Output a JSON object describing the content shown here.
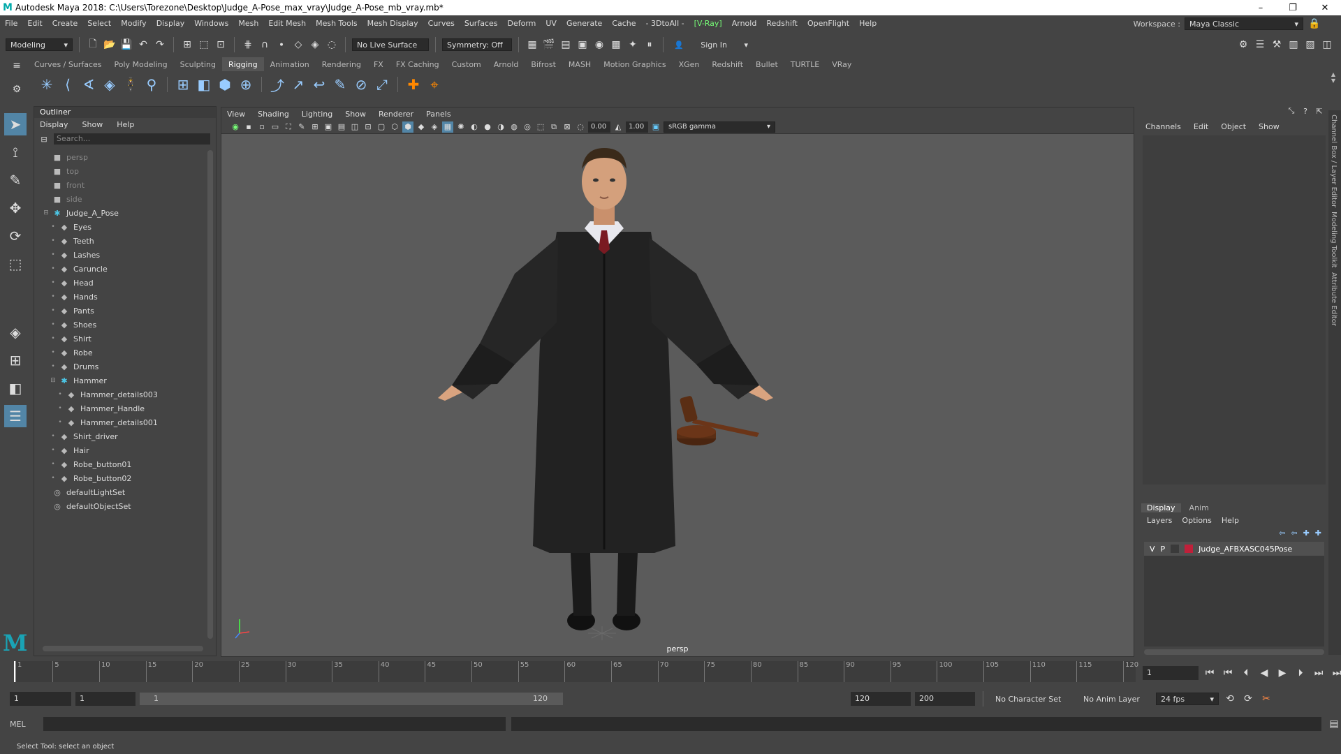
{
  "window": {
    "title": "Autodesk Maya 2018: C:\\Users\\Torezone\\Desktop\\Judge_A-Pose_max_vray\\Judge_A-Pose_mb_vray.mb*"
  },
  "menus": [
    "File",
    "Edit",
    "Create",
    "Select",
    "Modify",
    "Display",
    "Windows",
    "Mesh",
    "Edit Mesh",
    "Mesh Tools",
    "Mesh Display",
    "Curves",
    "Surfaces",
    "Deform",
    "UV",
    "Generate",
    "Cache",
    "- 3DtoAll -",
    "[V-Ray]",
    "Arnold",
    "Redshift",
    "OpenFlight",
    "Help"
  ],
  "workspace": {
    "label": "Workspace :",
    "value": "Maya Classic"
  },
  "status": {
    "mode": "Modeling",
    "live_surface": "No Live Surface",
    "symmetry": "Symmetry: Off",
    "sign_in": "Sign In"
  },
  "shelf_tabs": [
    "Curves / Surfaces",
    "Poly Modeling",
    "Sculpting",
    "Rigging",
    "Animation",
    "Rendering",
    "FX",
    "FX Caching",
    "Custom",
    "Arnold",
    "Bifrost",
    "MASH",
    "Motion Graphics",
    "XGen",
    "Redshift",
    "Bullet",
    "TURTLE",
    "VRay"
  ],
  "shelf_active": "Rigging",
  "outliner": {
    "title": "Outliner",
    "menu": [
      "Display",
      "Show",
      "Help"
    ],
    "search_placeholder": "Search...",
    "nodes": [
      {
        "label": "persp",
        "type": "camera",
        "depth": 0,
        "dim": true
      },
      {
        "label": "top",
        "type": "camera",
        "depth": 0,
        "dim": true
      },
      {
        "label": "front",
        "type": "camera",
        "depth": 0,
        "dim": true
      },
      {
        "label": "side",
        "type": "camera",
        "depth": 0,
        "dim": true
      },
      {
        "label": "Judge_A_Pose",
        "type": "joint",
        "depth": 0,
        "expand": "minus"
      },
      {
        "label": "Eyes",
        "type": "mesh",
        "depth": 1,
        "expand": "plus"
      },
      {
        "label": "Teeth",
        "type": "mesh",
        "depth": 1,
        "expand": "plus"
      },
      {
        "label": "Lashes",
        "type": "mesh",
        "depth": 1,
        "expand": "plus"
      },
      {
        "label": "Caruncle",
        "type": "mesh",
        "depth": 1,
        "expand": "plus"
      },
      {
        "label": "Head",
        "type": "mesh",
        "depth": 1,
        "expand": "plus"
      },
      {
        "label": "Hands",
        "type": "mesh",
        "depth": 1,
        "expand": "plus"
      },
      {
        "label": "Pants",
        "type": "mesh",
        "depth": 1,
        "expand": "plus"
      },
      {
        "label": "Shoes",
        "type": "mesh",
        "depth": 1,
        "expand": "plus"
      },
      {
        "label": "Shirt",
        "type": "mesh",
        "depth": 1,
        "expand": "plus"
      },
      {
        "label": "Robe",
        "type": "mesh",
        "depth": 1,
        "expand": "plus"
      },
      {
        "label": "Drums",
        "type": "mesh",
        "depth": 1,
        "expand": "plus"
      },
      {
        "label": "Hammer",
        "type": "joint",
        "depth": 1,
        "expand": "minus"
      },
      {
        "label": "Hammer_details003",
        "type": "mesh",
        "depth": 2,
        "expand": "plus"
      },
      {
        "label": "Hammer_Handle",
        "type": "mesh",
        "depth": 2,
        "expand": "plus"
      },
      {
        "label": "Hammer_details001",
        "type": "mesh",
        "depth": 2,
        "expand": "plus"
      },
      {
        "label": "Shirt_driver",
        "type": "mesh",
        "depth": 1,
        "expand": "plus"
      },
      {
        "label": "Hair",
        "type": "mesh",
        "depth": 1,
        "expand": "plus"
      },
      {
        "label": "Robe_button01",
        "type": "mesh",
        "depth": 1,
        "expand": "plus"
      },
      {
        "label": "Robe_button02",
        "type": "mesh",
        "depth": 1,
        "expand": "plus"
      },
      {
        "label": "defaultLightSet",
        "type": "set",
        "depth": 0
      },
      {
        "label": "defaultObjectSet",
        "type": "set",
        "depth": 0
      }
    ]
  },
  "viewport": {
    "menu": [
      "View",
      "Shading",
      "Lighting",
      "Show",
      "Renderer",
      "Panels"
    ],
    "exposure": "0.00",
    "gamma": "1.00",
    "color_space": "sRGB gamma",
    "camera": "persp"
  },
  "channel_box": {
    "menu": [
      "Channels",
      "Edit",
      "Object",
      "Show"
    ]
  },
  "layer_editor": {
    "tabs": [
      "Display",
      "Anim"
    ],
    "menu": [
      "Layers",
      "Options",
      "Help"
    ],
    "layers": [
      {
        "v": "V",
        "p": "P",
        "name": "Judge_AFBXASC045Pose",
        "color": "#c0203a"
      }
    ]
  },
  "side_tabs": [
    "Channel Box / Layer Editor",
    "Modeling Toolkit",
    "Attribute Editor"
  ],
  "timeline": {
    "ticks": [
      1,
      5,
      10,
      15,
      20,
      25,
      30,
      35,
      40,
      45,
      50,
      55,
      60,
      65,
      70,
      75,
      80,
      85,
      90,
      95,
      100,
      105,
      110,
      115,
      120
    ],
    "current_frame": "1"
  },
  "range": {
    "start": "1",
    "playback_start": "1",
    "slider_start": "1",
    "slider_end": "120",
    "playback_end": "120",
    "end": "200",
    "character_set": "No Character Set",
    "anim_layer": "No Anim Layer",
    "fps": "24 fps"
  },
  "command": {
    "label": "MEL"
  },
  "help_line": "Select Tool: select an object",
  "colors": {
    "accent": "#5285a6",
    "bg": "#444444",
    "viewport": "#5b5b5b",
    "maya_teal": "#1aa3b5"
  }
}
